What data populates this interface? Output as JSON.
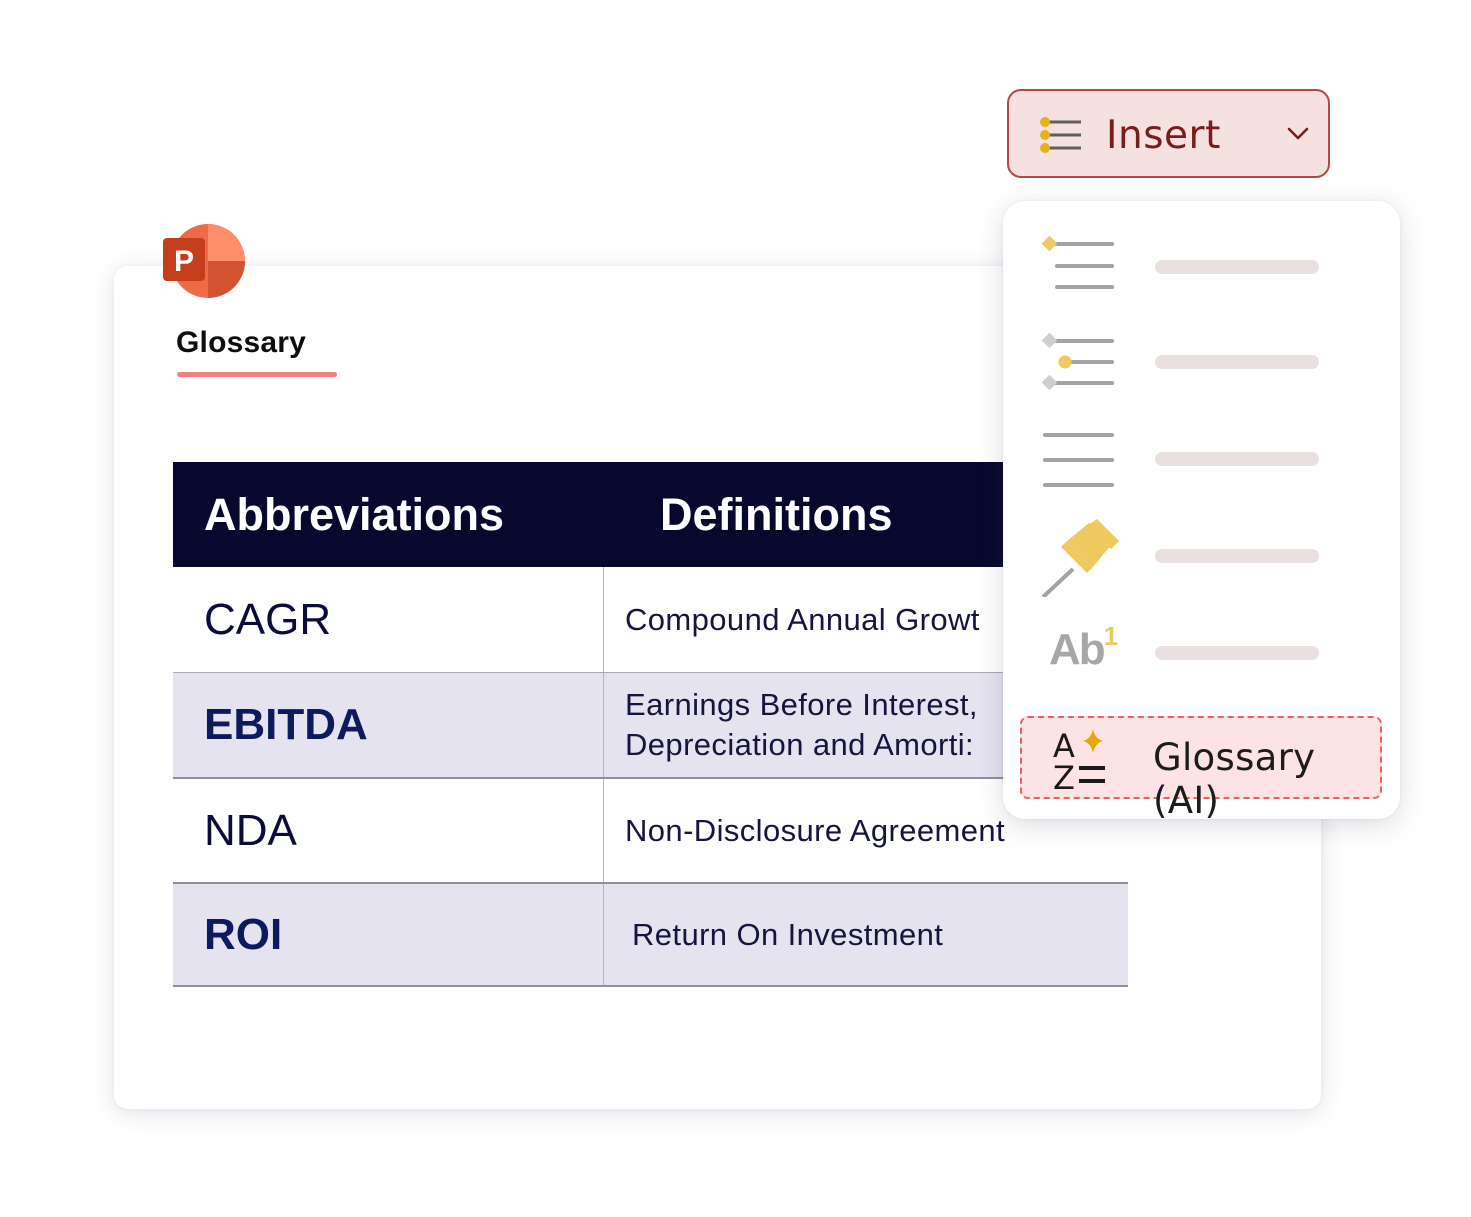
{
  "insert_button": {
    "label": "Insert",
    "icon": "bulleted-list-icon",
    "dropdown_icon": "chevron-down-icon"
  },
  "slide": {
    "app_icon": "powerpoint-logo",
    "app_letter": "P",
    "title": "Glossary",
    "table": {
      "columns": [
        "Abbreviations",
        "Definitions"
      ],
      "rows": [
        {
          "abbr": "CAGR",
          "definition": "Compound Annual Growt"
        },
        {
          "abbr": "EBITDA",
          "definition_line1": "Earnings Before Interest,",
          "definition_line2": "Depreciation and Amorti:"
        },
        {
          "abbr": "NDA",
          "definition": "Non-Disclosure Agreement"
        },
        {
          "abbr": "ROI",
          "definition": "Return On Investment"
        }
      ]
    }
  },
  "insert_menu": {
    "items": [
      {
        "icon": "bulleted-list-icon",
        "label_placeholder": true
      },
      {
        "icon": "multilevel-list-icon",
        "label_placeholder": true
      },
      {
        "icon": "plain-lines-icon",
        "label_placeholder": true
      },
      {
        "icon": "pushpin-icon",
        "label_placeholder": true
      },
      {
        "icon": "footnote-icon",
        "icon_text": "Ab",
        "icon_superscript": "1",
        "label_placeholder": true
      }
    ],
    "highlighted_item": {
      "label": "Glossary (AI)",
      "icon": "sort-az-sparkle-icon",
      "icon_top": "A",
      "icon_bottom": "Z"
    }
  },
  "colors": {
    "table_header_bg": "#08082f",
    "alt_row_bg": "#e5e3ef",
    "insert_bg": "#f6e1e1",
    "insert_border": "#b24848",
    "insert_text": "#7a1c1c",
    "accent_gold": "#f0c95e",
    "highlight_bg": "#fde3e4",
    "highlight_border": "#ee5f5f",
    "title_underline": "#f38383"
  }
}
